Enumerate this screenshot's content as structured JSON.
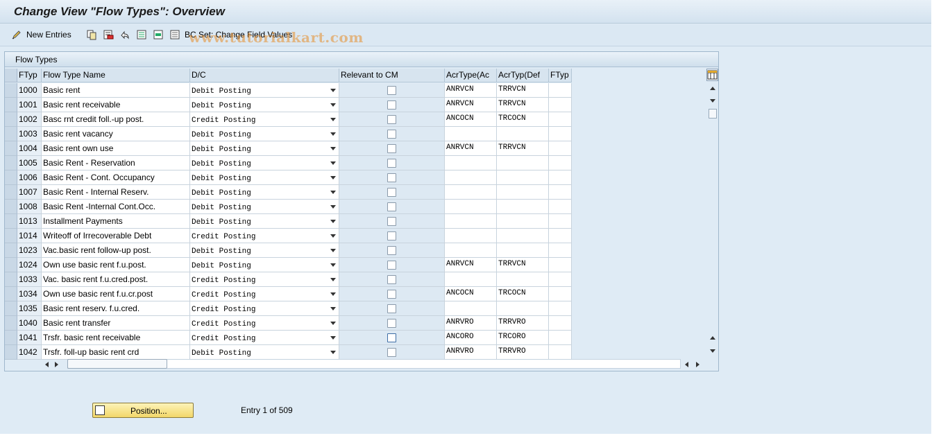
{
  "window": {
    "title": "Change View \"Flow Types\": Overview"
  },
  "toolbar": {
    "new_entries_label": "New Entries",
    "bc_set_label": "BC Set: Change Field Values",
    "watermark": "www.tutorialkart.com"
  },
  "panel": {
    "title": "Flow Types"
  },
  "table": {
    "headers": [
      "FTyp",
      "Flow Type Name",
      "D/C",
      "Relevant to CM",
      "AcrType(Ac",
      "AcrTyp(Def",
      "FTyp"
    ],
    "rows": [
      {
        "ftyp": "1000",
        "name": "Basic rent",
        "dc": "Debit Posting",
        "acr": "ANRVCN",
        "acrdef": "TRRVCN"
      },
      {
        "ftyp": "1001",
        "name": "Basic rent receivable",
        "dc": "Debit Posting",
        "acr": "ANRVCN",
        "acrdef": "TRRVCN"
      },
      {
        "ftyp": "1002",
        "name": "Basc rnt credit foll.-up post.",
        "dc": "Credit Posting",
        "acr": "ANCOCN",
        "acrdef": "TRCOCN"
      },
      {
        "ftyp": "1003",
        "name": "Basic rent vacancy",
        "dc": "Debit Posting",
        "acr": "",
        "acrdef": ""
      },
      {
        "ftyp": "1004",
        "name": "Basic rent own use",
        "dc": "Debit Posting",
        "acr": "ANRVCN",
        "acrdef": "TRRVCN"
      },
      {
        "ftyp": "1005",
        "name": "Basic Rent - Reservation",
        "dc": "Debit Posting",
        "acr": "",
        "acrdef": ""
      },
      {
        "ftyp": "1006",
        "name": "Basic Rent - Cont. Occupancy",
        "dc": "Debit Posting",
        "acr": "",
        "acrdef": ""
      },
      {
        "ftyp": "1007",
        "name": "Basic Rent - Internal Reserv.",
        "dc": "Debit Posting",
        "acr": "",
        "acrdef": ""
      },
      {
        "ftyp": "1008",
        "name": "Basic Rent -Internal Cont.Occ.",
        "dc": "Debit Posting",
        "acr": "",
        "acrdef": ""
      },
      {
        "ftyp": "1013",
        "name": "Installment Payments",
        "dc": "Debit Posting",
        "acr": "",
        "acrdef": ""
      },
      {
        "ftyp": "1014",
        "name": "Writeoff of Irrecoverable Debt",
        "dc": "Credit Posting",
        "acr": "",
        "acrdef": ""
      },
      {
        "ftyp": "1023",
        "name": "Vac.basic rent follow-up post.",
        "dc": "Debit Posting",
        "acr": "",
        "acrdef": ""
      },
      {
        "ftyp": "1024",
        "name": "Own use basic rent f.u.post.",
        "dc": "Debit Posting",
        "acr": "ANRVCN",
        "acrdef": "TRRVCN"
      },
      {
        "ftyp": "1033",
        "name": "Vac. basic rent f.u.cred.post.",
        "dc": "Credit Posting",
        "acr": "",
        "acrdef": ""
      },
      {
        "ftyp": "1034",
        "name": "Own use basic rent f.u.cr.post",
        "dc": "Credit Posting",
        "acr": "ANCOCN",
        "acrdef": "TRCOCN"
      },
      {
        "ftyp": "1035",
        "name": "Basic rent reserv. f.u.cred.",
        "dc": "Credit Posting",
        "acr": "",
        "acrdef": ""
      },
      {
        "ftyp": "1040",
        "name": "Basic rent transfer",
        "dc": "Credit Posting",
        "acr": "ANRVRO",
        "acrdef": "TRRVRO"
      },
      {
        "ftyp": "1041",
        "name": "Trsfr. basic rent receivable",
        "dc": "Credit Posting",
        "acr": "ANCORO",
        "acrdef": "TRCORO"
      },
      {
        "ftyp": "1042",
        "name": "Trsfr. foll-up basic rent crd",
        "dc": "Debit Posting",
        "acr": "ANRVRO",
        "acrdef": "TRRVRO"
      }
    ]
  },
  "footer": {
    "position_label": "Position...",
    "entry_info": "Entry 1 of 509"
  },
  "colors": {
    "position_button": "#f2d769",
    "watermark": "#e68c28"
  }
}
